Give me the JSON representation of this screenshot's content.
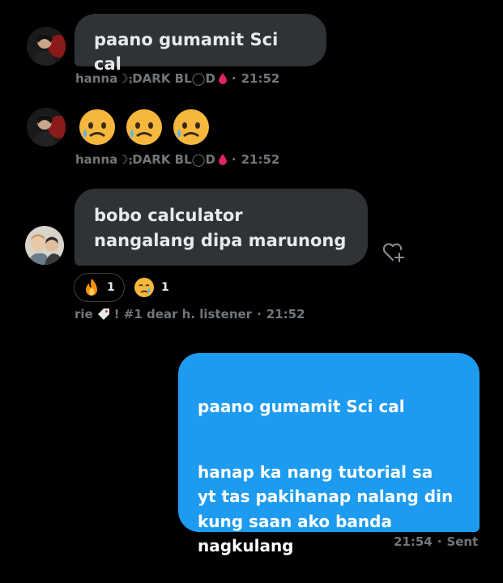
{
  "messages": [
    {
      "author": "hanna☽⨟DARK BL◯D",
      "text": "paano gumamit Sci cal",
      "time": "21:52"
    },
    {
      "author": "hanna☽⨟DARK BL◯D",
      "emojis": [
        "sad-sweat-face",
        "sad-sweat-face",
        "sad-sweat-face"
      ],
      "time": "21:52"
    },
    {
      "author": "rie",
      "author_suffix": "! #1 dear h. listener",
      "text": "bobo calculator nangalang dipa marunong",
      "time": "21:52",
      "reactions": [
        {
          "emoji": "fire",
          "count": "1"
        },
        {
          "emoji": "crying-face",
          "count": "1"
        }
      ]
    },
    {
      "quoted": "paano gumamit Sci cal",
      "text": "hanap ka nang tutorial sa\nyt tas pakihanap nalang din\nkung saan ako banda\nnagkulang",
      "time": "21:54",
      "status": "Sent"
    }
  ],
  "dot": "·",
  "colors": {
    "incoming_bubble": "#2f3336",
    "outgoing_bubble": "#1d9bf0",
    "meta": "#71767b",
    "blood": "#e0245e"
  }
}
